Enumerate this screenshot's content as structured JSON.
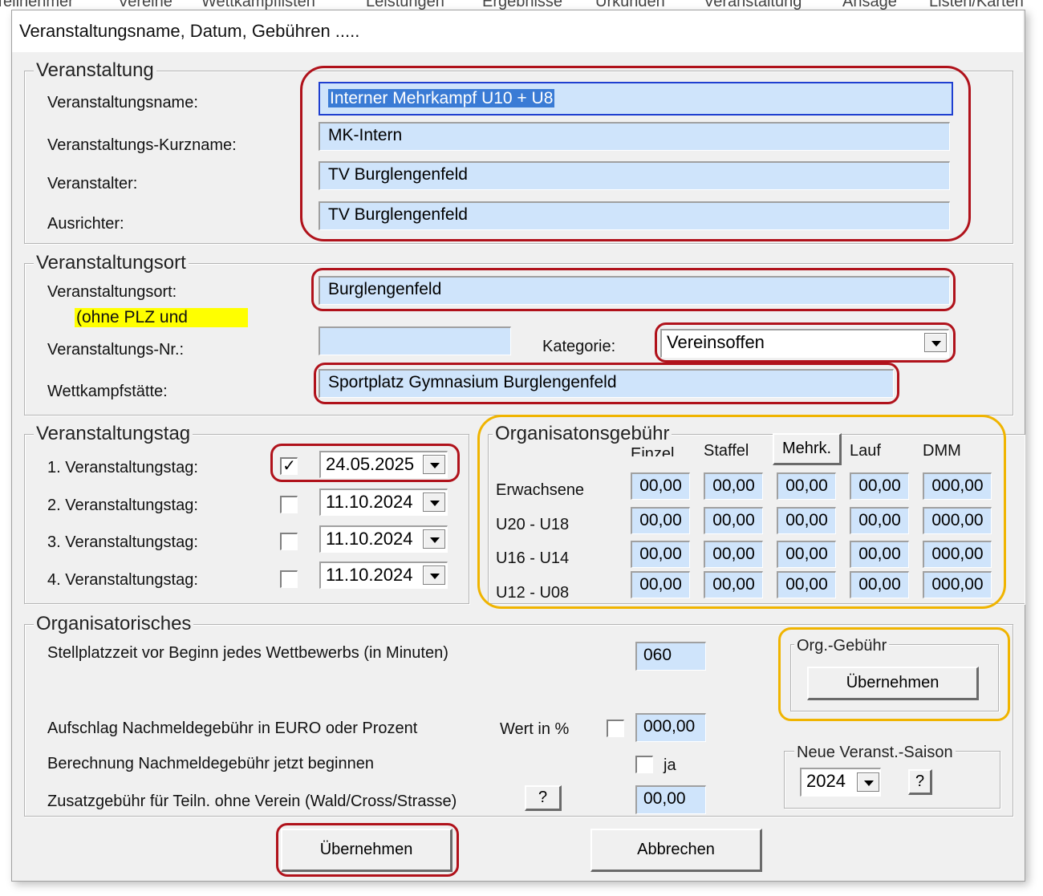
{
  "menu": [
    "Teilnehmer",
    "Vereine",
    "Wettkampflisten",
    "Leistungen",
    "Ergebnisse",
    "Urkunden",
    "Veranstaltung",
    "Ansage",
    "Listen/Karten"
  ],
  "window": {
    "title": "Veranstaltungsname, Datum, Gebühren ....."
  },
  "veranstaltung": {
    "legend": "Veranstaltung",
    "name_label": "Veranstaltungsname:",
    "name_value": "Interner Mehrkampf U10 + U8",
    "kurzname_label": "Veranstaltungs-Kurzname:",
    "kurzname_value": "MK-Intern",
    "veranstalter_label": "Veranstalter:",
    "veranstalter_value": "TV Burglengenfeld",
    "ausrichter_label": "Ausrichter:",
    "ausrichter_value": "TV Burglengenfeld"
  },
  "ort": {
    "legend": "Veranstaltungsort",
    "ort_label": "Veranstaltungsort:",
    "ort_value": "Burglengenfeld",
    "hint": "(ohne PLZ und",
    "nr_label": "Veranstaltungs-Nr.:",
    "nr_value": "",
    "kategorie_label": "Kategorie:",
    "kategorie_value": "Vereinsoffen",
    "staette_label": "Wettkampfstätte:",
    "staette_value": "Sportplatz Gymnasium Burglengenfeld"
  },
  "tag": {
    "legend": "Veranstaltungstag",
    "days": [
      {
        "label": "1. Veranstaltungstag:",
        "checked": true,
        "date": "24.05.2025"
      },
      {
        "label": "2. Veranstaltungstag:",
        "checked": false,
        "date": "11.10.2024"
      },
      {
        "label": "3. Veranstaltungstag:",
        "checked": false,
        "date": "11.10.2024"
      },
      {
        "label": "4. Veranstaltungstag:",
        "checked": false,
        "date": "11.10.2024"
      }
    ],
    "check_mark": "✓"
  },
  "gebuehr": {
    "legend": "Organisatonsgebühr",
    "columns": [
      "Einzel",
      "Staffel",
      "Mehrk.",
      "Lauf",
      "DMM"
    ],
    "rows": [
      {
        "label": "Erwachsene",
        "values": [
          "00,00",
          "00,00",
          "00,00",
          "00,00",
          "000,00"
        ]
      },
      {
        "label": "U20 - U18",
        "values": [
          "00,00",
          "00,00",
          "00,00",
          "00,00",
          "000,00"
        ]
      },
      {
        "label": "U16 - U14",
        "values": [
          "00,00",
          "00,00",
          "00,00",
          "00,00",
          "000,00"
        ]
      },
      {
        "label": "U12 - U08",
        "values": [
          "00,00",
          "00,00",
          "00,00",
          "00,00",
          "000,00"
        ]
      }
    ]
  },
  "org": {
    "legend": "Organisatorisches",
    "stellplatz_label": "Stellplatzzeit vor Beginn jedes Wettbewerbs (in Minuten)",
    "stellplatz_value": "060",
    "aufschlag_label": "Aufschlag Nachmeldegebühr in EURO oder Prozent",
    "wert_label": "Wert in %",
    "aufschlag_value": "000,00",
    "berechnung_label": "Berechnung Nachmeldegebühr jetzt beginnen",
    "ja_label": "ja",
    "zusatz_label": "Zusatzgebühr für Teiln. ohne Verein (Wald/Cross/Strasse)",
    "help_label": "?",
    "zusatz_value": "00,00"
  },
  "orggebuehr_box": {
    "legend": "Org.-Gebühr",
    "button": "Übernehmen"
  },
  "saison": {
    "legend": "Neue Veranst.-Saison",
    "value": "2024",
    "help_label": "?"
  },
  "footer": {
    "ok": "Übernehmen",
    "cancel": "Abbrechen"
  }
}
